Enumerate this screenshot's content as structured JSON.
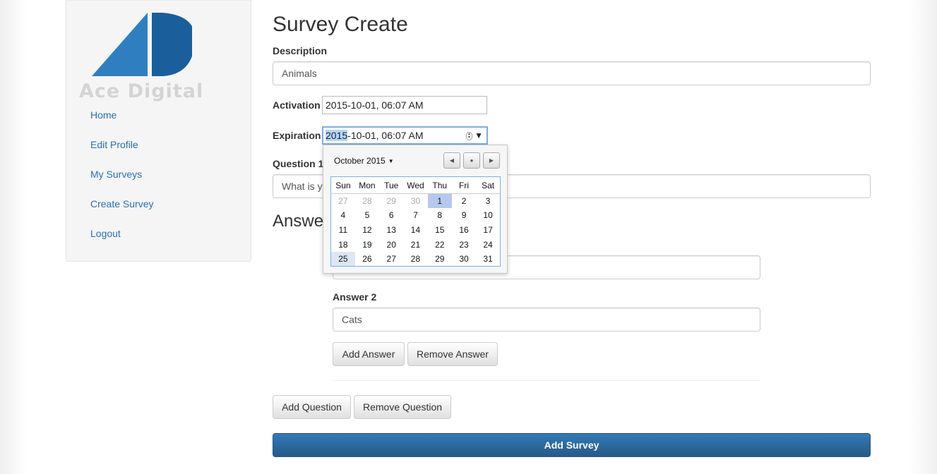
{
  "brand": {
    "logo_text": "Ace Digital",
    "logo_color": "#1a5f9c"
  },
  "nav": [
    "Home",
    "Edit Profile",
    "My Surveys",
    "Create Survey",
    "Logout"
  ],
  "page": {
    "title": "Survey Create",
    "description_label": "Description",
    "description_value": "Animals",
    "activation_label": "Activation",
    "activation_value": "2015-10-01, 06:07 AM",
    "expiration_label": "Expiration",
    "expiration_value_year": "2015",
    "expiration_value_rest": "-10-01, 06:07 AM",
    "question_label": "Question 1",
    "question_value": "What is yo",
    "answers_heading": "Answe",
    "answer2_label": "Answer 2",
    "answer2_value": "Cats",
    "add_answer": "Add Answer",
    "remove_answer": "Remove Answer",
    "add_question": "Add Question",
    "remove_question": "Remove Question",
    "submit": "Add Survey"
  },
  "calendar": {
    "month_label": "October 2015",
    "weekdays": [
      "Sun",
      "Mon",
      "Tue",
      "Wed",
      "Thu",
      "Fri",
      "Sat"
    ],
    "weeks": [
      [
        "27",
        "28",
        "29",
        "30",
        "1",
        "2",
        "3"
      ],
      [
        "4",
        "5",
        "6",
        "7",
        "8",
        "9",
        "10"
      ],
      [
        "11",
        "12",
        "13",
        "14",
        "15",
        "16",
        "17"
      ],
      [
        "18",
        "19",
        "20",
        "21",
        "22",
        "23",
        "24"
      ],
      [
        "25",
        "26",
        "27",
        "28",
        "29",
        "30",
        "31"
      ]
    ],
    "selected_day": "1",
    "today_day": "25"
  },
  "colors": {
    "primary": "#2a6fb5",
    "link": "#2a6fb5"
  }
}
